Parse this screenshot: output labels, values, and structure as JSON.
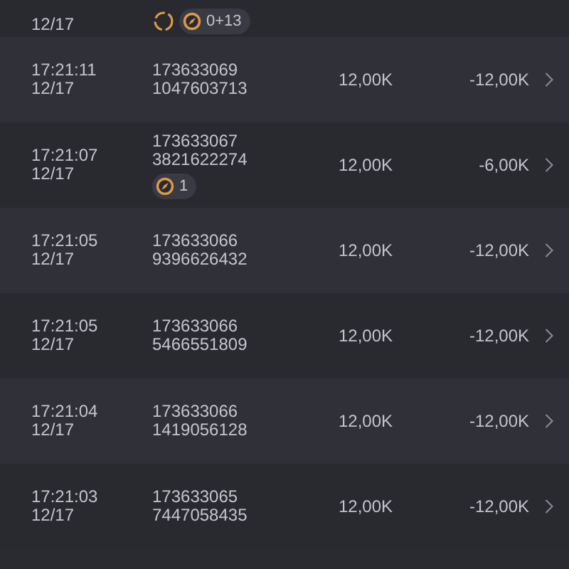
{
  "rows": [
    {
      "date": "12/17",
      "badges": [
        {
          "kind": "sync"
        },
        {
          "kind": "count",
          "text": "0+13"
        }
      ]
    },
    {
      "time": "17:21:11",
      "date": "12/17",
      "id": "173633069",
      "ticket": "1047603713",
      "amount": "12,00K",
      "net": "-12,00K"
    },
    {
      "time": "17:21:07",
      "date": "12/17",
      "id": "173633067",
      "ticket": "3821622274",
      "amount": "12,00K",
      "net": "-6,00K",
      "badges": [
        {
          "kind": "count",
          "text": "1"
        }
      ]
    },
    {
      "time": "17:21:05",
      "date": "12/17",
      "id": "173633066",
      "ticket": "9396626432",
      "amount": "12,00K",
      "net": "-12,00K"
    },
    {
      "time": "17:21:05",
      "date": "12/17",
      "id": "173633066",
      "ticket": "5466551809",
      "amount": "12,00K",
      "net": "-12,00K"
    },
    {
      "time": "17:21:04",
      "date": "12/17",
      "id": "173633066",
      "ticket": "1419056128",
      "amount": "12,00K",
      "net": "-12,00K"
    },
    {
      "time": "17:21:03",
      "date": "12/17",
      "id": "173633065",
      "ticket": "7447058435",
      "amount": "12,00K",
      "net": "-12,00K"
    }
  ]
}
